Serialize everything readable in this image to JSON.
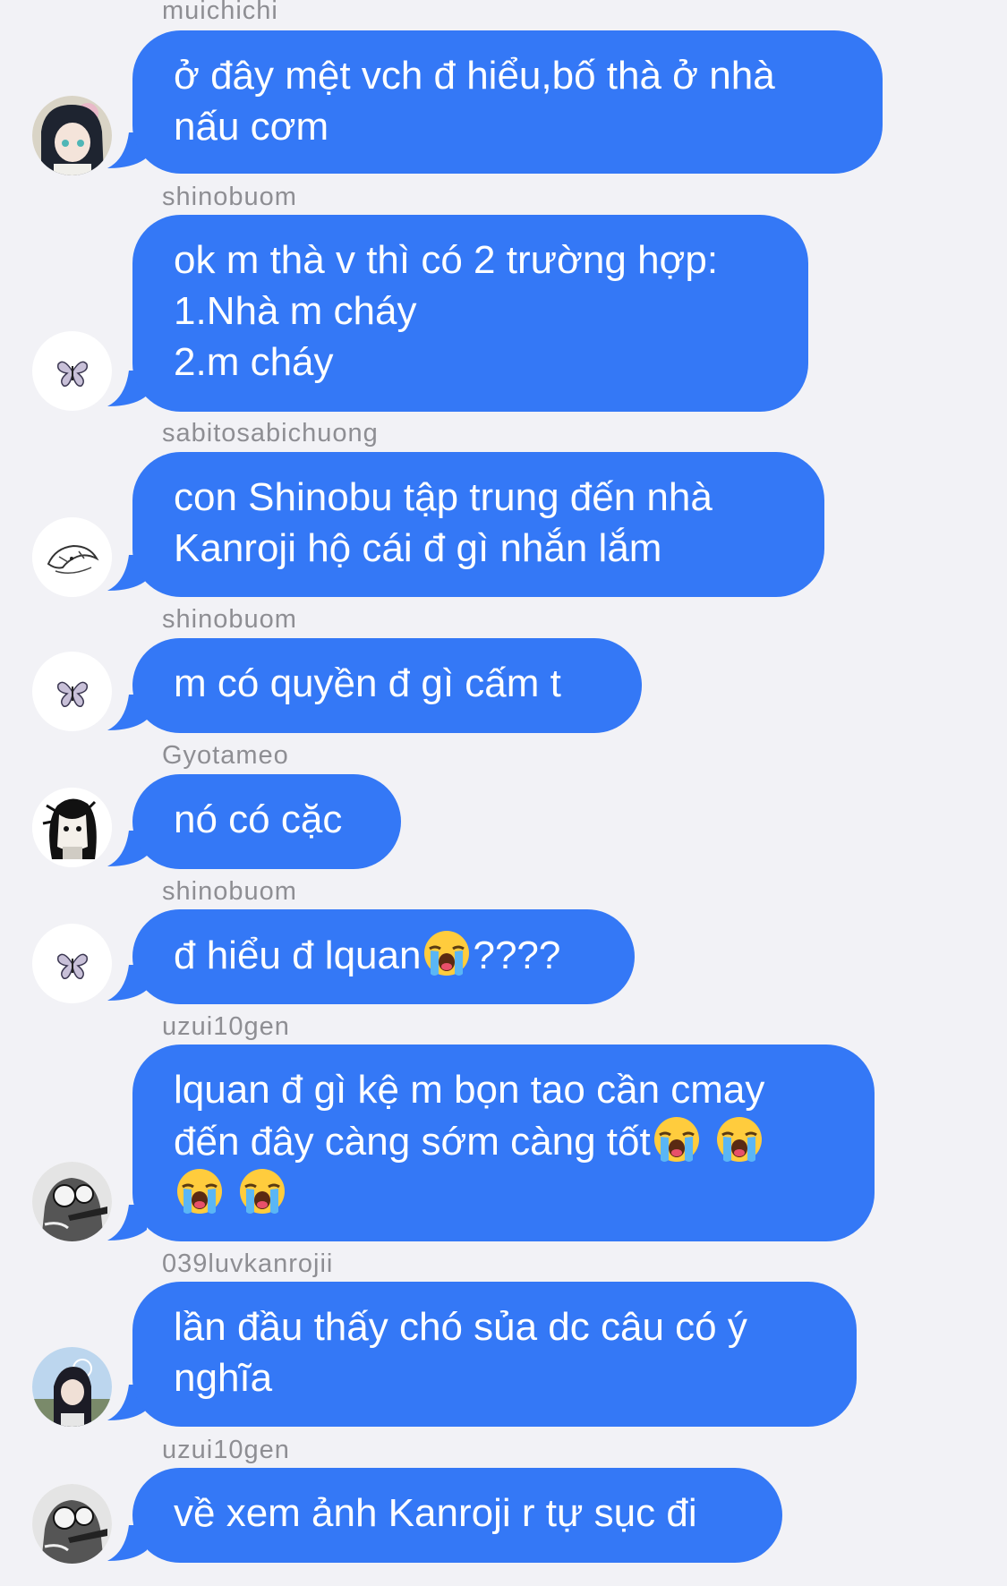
{
  "messages": [
    {
      "username": "muichichi",
      "avatar_icon": "muichiro-avatar-icon",
      "lines": [
        "ở đây mệt vch đ hiểu,bố thà ở nhà",
        "nấu cơm"
      ]
    },
    {
      "username": "shinobuom",
      "avatar_icon": "butterfly-avatar-icon",
      "lines": [
        "ok m thà v thì có 2 trường hợp:",
        "1.Nhà m cháy",
        "2.m cháy"
      ]
    },
    {
      "username": "sabitosabichuong",
      "avatar_icon": "sketch-avatar-icon",
      "lines": [
        "con Shinobu tập trung đến nhà",
        "Kanroji hộ cái đ gì nhắn lắm"
      ]
    },
    {
      "username": "shinobuom",
      "avatar_icon": "butterfly-avatar-icon",
      "lines": [
        "m có quyền đ gì cấm t"
      ]
    },
    {
      "username": "Gyotameo",
      "avatar_icon": "manga-avatar-icon",
      "lines": [
        "nó có cặc"
      ]
    },
    {
      "username": "shinobuom",
      "avatar_icon": "butterfly-avatar-icon",
      "lines": [
        "đ hiểu đ lquan",
        "????"
      ],
      "emoji": "loudly-crying-face"
    },
    {
      "username": "uzui10gen",
      "avatar_icon": "manga-gray-avatar-icon",
      "lines": [
        "lquan đ gì kệ m bọn tao cần cmay",
        "đến đây càng sớm càng tốt"
      ],
      "emoji": "loudly-crying-face"
    },
    {
      "username": "039luvkanrojii",
      "avatar_icon": "obanai-avatar-icon",
      "lines": [
        "lần đầu thấy chó sủa dc câu có ý",
        "nghĩa"
      ]
    },
    {
      "username": "uzui10gen",
      "avatar_icon": "manga-gray-avatar-icon",
      "lines": [
        "về xem ảnh Kanroji r tự sục đi"
      ]
    }
  ],
  "colors": {
    "background": "#f2f2f6",
    "bubble": "#3478f6",
    "bubble_text": "#ffffff",
    "username": "#8e8e93"
  }
}
